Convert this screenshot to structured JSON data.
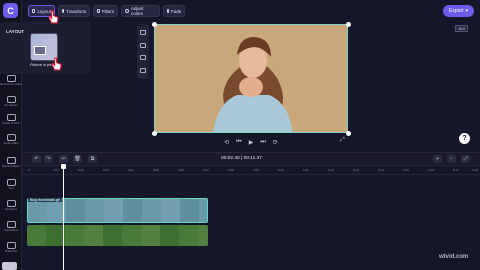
{
  "app": {
    "logo_letter": "C",
    "accent": "#6c5ce7"
  },
  "toolbar": {
    "buttons": [
      "Layout",
      "Transform",
      "Filters",
      "Adjust colors",
      "Fade"
    ],
    "export_label": "Export",
    "export_chevron": "▾"
  },
  "rail": {
    "items": [
      "Record & create",
      "Templates",
      "Music & SFX",
      "Stock video",
      "Stock images",
      "Text",
      "Graphics",
      "Transitions",
      "Brand Kit"
    ]
  },
  "panel": {
    "title": "LAYOUT",
    "thumb_label": "Picture in pict..."
  },
  "preview": {
    "aspect_ratio": "16:9"
  },
  "playback": {
    "back_5": "⟲",
    "rewind": "⏮",
    "play": "▶",
    "forward": "⏭",
    "skip_5": "⟳",
    "fullscreen": "⤢",
    "help": "?"
  },
  "timeline": {
    "timecode": "00:02.40 | 00:11.37",
    "ruler": [
      "0",
      "0:01",
      "0:02",
      "0:03",
      "0:04",
      "0:05",
      "0:06",
      "0:07",
      "0:08",
      "0:09",
      "0:10",
      "0:11",
      "0:12",
      "0:13",
      "0:14",
      "0:15",
      "0:16",
      "0:17",
      "0:18"
    ],
    "track1_label": "Blog thumbnails.gif",
    "undo": "↶",
    "redo": "↷",
    "cut": "✂",
    "delete": "🗑",
    "duplicate": "⧉",
    "zoom_in": "+",
    "zoom_out": "−",
    "fit": "⤢"
  },
  "watermark": "wtvid.com"
}
